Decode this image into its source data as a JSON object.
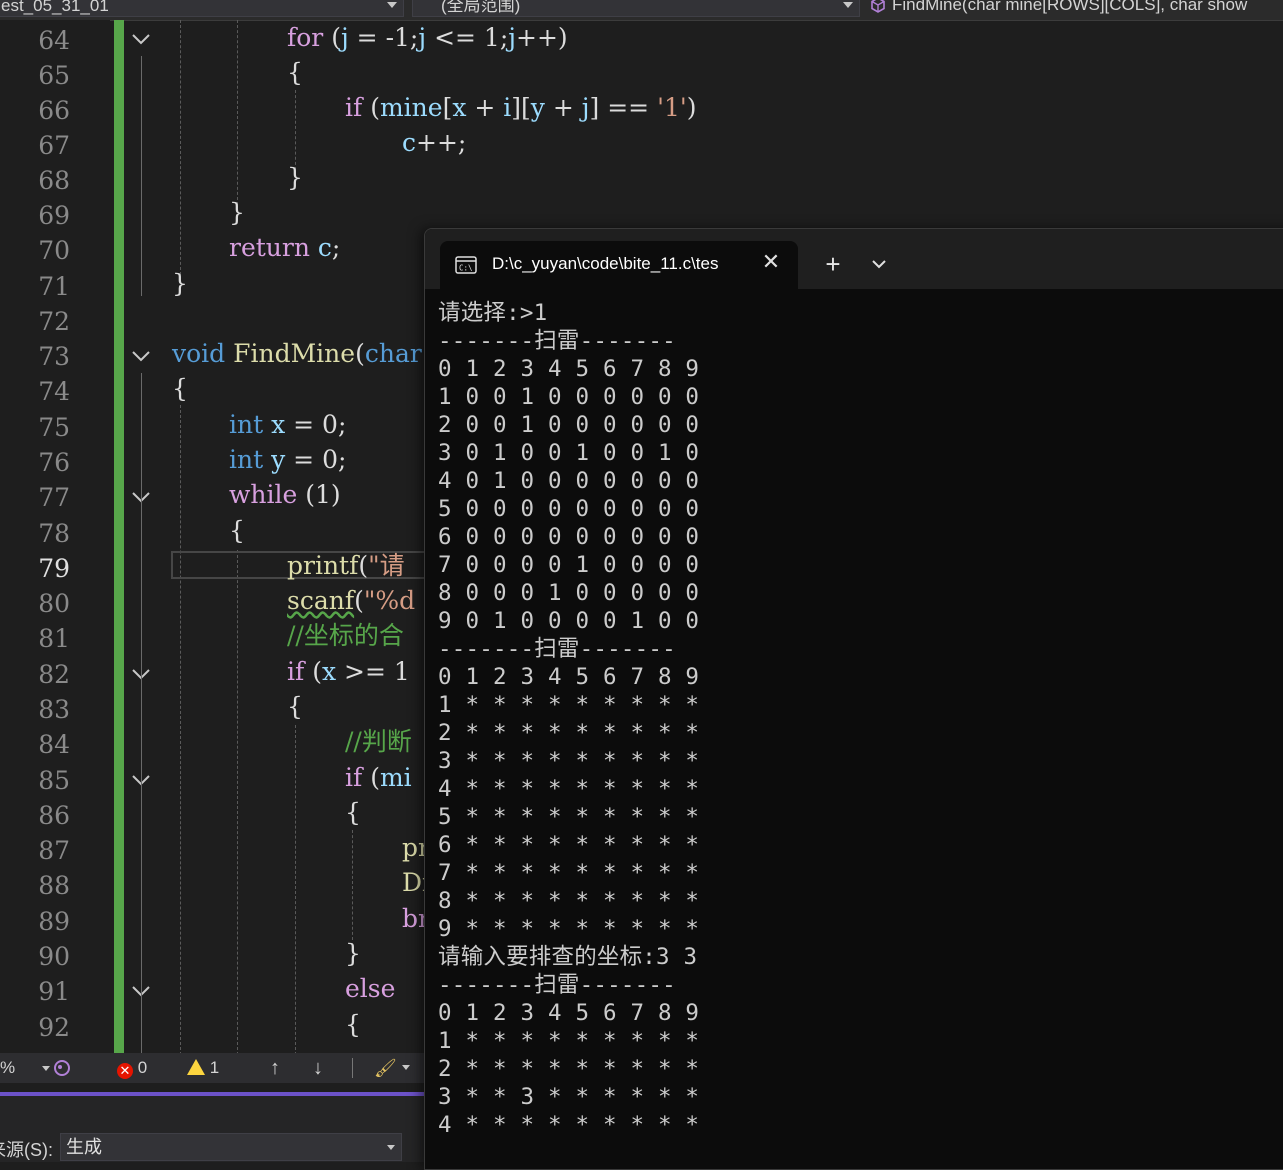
{
  "navbar": {
    "project": "est_05_31_01",
    "scope": "(全局范围)",
    "member": "FindMine(char mine[ROWS][COLS], char show"
  },
  "editor": {
    "line_numbers": [
      "64",
      "65",
      "66",
      "67",
      "68",
      "69",
      "70",
      "71",
      "72",
      "73",
      "74",
      "75",
      "76",
      "77",
      "78",
      "79",
      "80",
      "81",
      "82",
      "83",
      "84",
      "85",
      "86",
      "87",
      "88",
      "89",
      "90",
      "91",
      "92"
    ],
    "current_line": "79"
  },
  "statusbar": {
    "zoom": "%",
    "errors": "0",
    "warnings": "1"
  },
  "output_panel": {
    "source_label": "来源(S):",
    "source_value": "生成"
  },
  "terminal": {
    "tab_title": "D:\\c_yuyan\\code\\bite_11.c\\tes",
    "lines": [
      "请选择:>1",
      "-------扫雷-------",
      "0 1 2 3 4 5 6 7 8 9",
      "1 0 0 1 0 0 0 0 0 0",
      "2 0 0 1 0 0 0 0 0 0",
      "3 0 1 0 0 1 0 0 1 0",
      "4 0 1 0 0 0 0 0 0 0",
      "5 0 0 0 0 0 0 0 0 0",
      "6 0 0 0 0 0 0 0 0 0",
      "7 0 0 0 0 1 0 0 0 0",
      "8 0 0 0 1 0 0 0 0 0",
      "9 0 1 0 0 0 0 1 0 0",
      "-------扫雷-------",
      "0 1 2 3 4 5 6 7 8 9",
      "1 * * * * * * * * *",
      "2 * * * * * * * * *",
      "3 * * * * * * * * *",
      "4 * * * * * * * * *",
      "5 * * * * * * * * *",
      "6 * * * * * * * * *",
      "7 * * * * * * * * *",
      "8 * * * * * * * * *",
      "9 * * * * * * * * *",
      "请输入要排查的坐标:3 3",
      "-------扫雷-------",
      "0 1 2 3 4 5 6 7 8 9",
      "1 * * * * * * * * *",
      "2 * * * * * * * * *",
      "3 * * 3 * * * * * *",
      "4 * * * * * * * * *"
    ]
  },
  "colors": {
    "editor_bg": "#1e1e1e",
    "change_bar": "#57a64a",
    "keyword": "#569cd6",
    "control_keyword": "#d8a0df",
    "function": "#dcdcaa",
    "string": "#d69d85",
    "comment": "#57a64a",
    "terminal_bg": "#0c0c0c"
  }
}
